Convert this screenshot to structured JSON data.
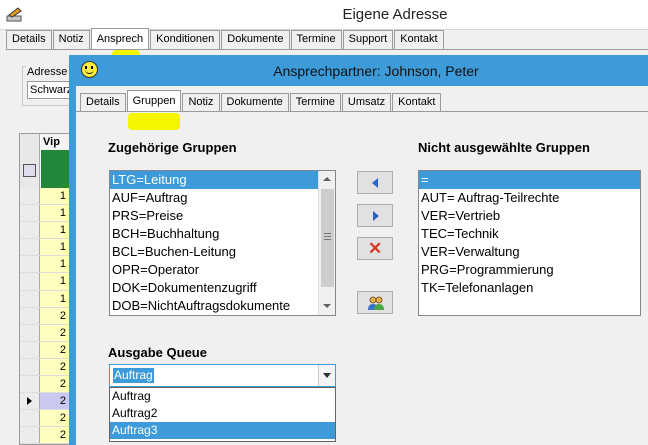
{
  "outer_window": {
    "title": "Eigene Adresse",
    "tabs": [
      "Details",
      "Notiz",
      "Ansprech",
      "Konditionen",
      "Dokumente",
      "Termine",
      "Support",
      "Kontakt"
    ],
    "active_tab": "Ansprech",
    "adresse_label": "Adresse",
    "adresse_value": "Schwarz",
    "grid": {
      "column_header": "Vip",
      "rows": [
        "1",
        "1",
        "1",
        "1",
        "1",
        "1",
        "1",
        "2",
        "2",
        "2",
        "2",
        "2",
        "2",
        "2",
        "2"
      ],
      "selected_row_index": 12
    }
  },
  "dialog": {
    "title": "Ansprechpartner: Johnson, Peter",
    "tabs": [
      "Details",
      "Gruppen",
      "Notiz",
      "Dokumente",
      "Termine",
      "Umsatz",
      "Kontakt"
    ],
    "active_tab": "Gruppen",
    "assigned_groups_label": "Zugehörige Gruppen",
    "assigned_groups": [
      "LTG=Leitung",
      "AUF=Auftrag",
      "PRS=Preise",
      "BCH=Buchhaltung",
      "BCL=Buchen-Leitung",
      "OPR=Operator",
      "DOK=Dokumentenzugriff",
      "DOB=NichtAuftragsdokumente"
    ],
    "assigned_selected_index": 0,
    "unassigned_groups_label": "Nicht ausgewählte Gruppen",
    "unassigned_groups": [
      "=",
      "AUT= Auftrag-Teilrechte",
      "VER=Vertrieb",
      "TEC=Technik",
      "VER=Verwaltung",
      "PRG=Programmierung",
      "TK=Telefonanlagen"
    ],
    "unassigned_selected_index": 0,
    "buttons": {
      "add": "arrow-left-icon",
      "remove": "arrow-right-icon",
      "delete": "red-x-icon",
      "group_members": "people-icon"
    },
    "queue_label": "Ausgabe Queue",
    "queue_value": "Auftrag",
    "queue_options": [
      "Auftrag",
      "Auftrag2",
      "Auftrag3"
    ],
    "queue_highlighted_index": 2
  },
  "colors": {
    "accent": "#3c9bd8",
    "highlight_marker": "#f5f500",
    "grid_green": "#23893a",
    "delete_red": "#d83a24"
  }
}
